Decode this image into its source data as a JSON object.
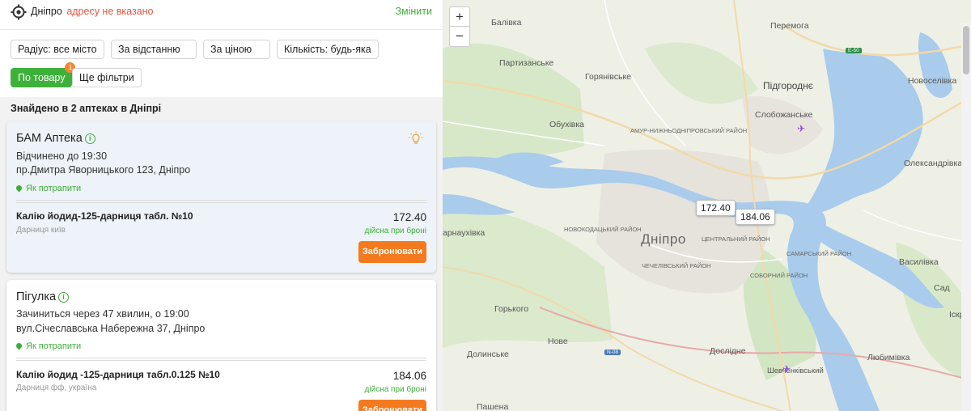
{
  "header": {
    "city": "Дніпро",
    "address_status": "адресу не вказано",
    "change_label": "Змінити"
  },
  "filters": {
    "radius": "Радіус: все місто",
    "by_distance": "За відстанню",
    "by_price": "За ціною",
    "quantity": "Кількість: будь-яка",
    "by_product": "По товару",
    "by_product_badge": "1",
    "more": "Ще фільтри"
  },
  "results": {
    "summary": "Знайдено в 2 аптеках в Дніпрі",
    "pharmacies": [
      {
        "name": "БАМ Аптека",
        "hours": "Відчинено до 19:30",
        "address": "пр.Дмитра Яворницького 123, Дніпро",
        "route": "Як потрапити",
        "product": "Калію йодид-125-дарниця табл. №10",
        "manufacturer": "Дарниця київ",
        "price": "172.40",
        "price_note": "дійсна при броні",
        "reserve": "Забронювати"
      },
      {
        "name": "Пігулка",
        "hours": "Зачиниться через 47 хвилин, о 19:00",
        "address": "вул.Січеславська Набережна 37, Дніпро",
        "route": "Як потрапити",
        "product": "Калію йодид -125-дарниця табл.0.125 №10",
        "manufacturer": "Дарниця фф, україна",
        "price": "184.06",
        "price_note": "дійсна при броні",
        "reserve": "Забронювати"
      }
    ]
  },
  "map": {
    "zoom_in": "+",
    "zoom_out": "−",
    "price_markers": [
      "172.40",
      "184.06"
    ],
    "labels": {
      "dnipro": "Дніпро",
      "balivka": "Балівка",
      "peremoha": "Перемога",
      "partyzanske": "Партизанське",
      "horianivske": "Горянівське",
      "pidhorodne": "Підгороднє",
      "novoselivka": "Новоселівка",
      "obukhivka": "Обухівка",
      "slobozhanske": "Слобожанське",
      "oleksandrivka": "Олександрівка",
      "karnaukhivka": "арнаухівка",
      "vasylivka": "Василівка",
      "sad": "Сад",
      "horkoho": "Горького",
      "nove": "Нове",
      "doslidne": "Дослідне",
      "dolynske": "Долинське",
      "liubymivka": "Любимівка",
      "shevchenkivskyi": "Шевченківський",
      "pashena": "Пашена",
      "iskra": "Іскра",
      "amur_district": "АМУР-НИЖНЬОДНІПРОВСЬКИЙ РАЙОН",
      "novokodatskyi_district": "НОВОКОДАЦЬКИЙ РАЙОН",
      "tsentralnyi_district": "ЦЕНТРАЛЬНИЙ РАЙОН",
      "samarskyi_district": "САМАРСЬКИЙ РАЙОН",
      "chechelivskyi_district": "ЧЕЧЕЛІВСЬКИЙ РАЙОН",
      "sobornyi_district": "СОБОРНИЙ РАЙОН",
      "road_e50": "E-50",
      "road_n08": "N-08"
    }
  },
  "colors": {
    "accent_green": "#3eb13a",
    "reserve_orange": "#f47a20",
    "address_red": "#e8553f",
    "water": "#a9cbec",
    "selected_card": "#edf3f8"
  }
}
